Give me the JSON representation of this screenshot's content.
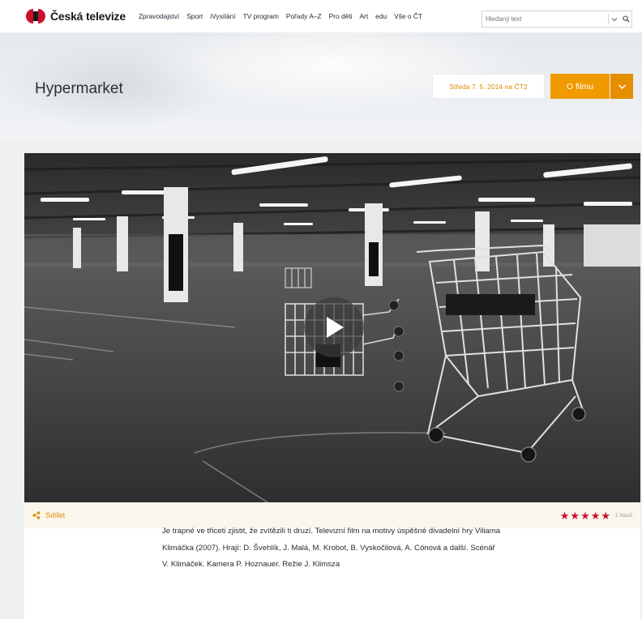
{
  "brand": {
    "name": "Česká televize",
    "colors": {
      "red": "#c8102e",
      "orange": "#f09a00",
      "dark": "#1a1a1a"
    }
  },
  "nav": {
    "items": [
      "Zpravodajství",
      "Sport",
      "iVysílání",
      "TV program",
      "Pořady A–Z",
      "Pro děti",
      "Art",
      "edu",
      "Vše o ČT"
    ]
  },
  "search": {
    "placeholder": "Hledaný text",
    "dropdown_icon": "chevron-down-icon",
    "submit_icon": "search-icon"
  },
  "program": {
    "title": "Hypermarket",
    "broadcast": "Středa 7. 5. 2014 na ČT2",
    "film_button": "O filmu"
  },
  "player": {
    "play_icon": "play-icon"
  },
  "share": {
    "label": "Sdílet",
    "icon": "share-icon"
  },
  "rating": {
    "stars": 5,
    "max": 5,
    "votes": "1 hlasů"
  },
  "description": "Je trapné ve třiceti zjistit, že zvítězili ti druzí. Televizní film na motivy úspěšné divadelní hry Viliama Klimáčka (2007). Hrají: D. Švehlík, J. Malá, M. Krobot, B. Vyskočilová, A. Cónová a další. Scénář V. Klimáček. Kamera P. Hoznauer. Režie J. Klimsza"
}
